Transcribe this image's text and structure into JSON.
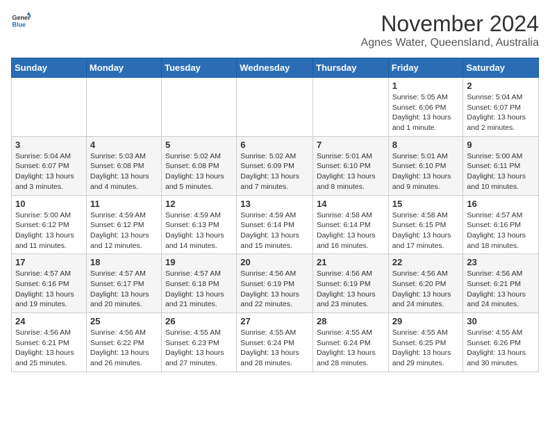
{
  "header": {
    "logo_line1": "General",
    "logo_line2": "Blue",
    "month": "November 2024",
    "location": "Agnes Water, Queensland, Australia"
  },
  "weekdays": [
    "Sunday",
    "Monday",
    "Tuesday",
    "Wednesday",
    "Thursday",
    "Friday",
    "Saturday"
  ],
  "weeks": [
    [
      {
        "day": "",
        "info": ""
      },
      {
        "day": "",
        "info": ""
      },
      {
        "day": "",
        "info": ""
      },
      {
        "day": "",
        "info": ""
      },
      {
        "day": "",
        "info": ""
      },
      {
        "day": "1",
        "info": "Sunrise: 5:05 AM\nSunset: 6:06 PM\nDaylight: 13 hours and 1 minute."
      },
      {
        "day": "2",
        "info": "Sunrise: 5:04 AM\nSunset: 6:07 PM\nDaylight: 13 hours and 2 minutes."
      }
    ],
    [
      {
        "day": "3",
        "info": "Sunrise: 5:04 AM\nSunset: 6:07 PM\nDaylight: 13 hours and 3 minutes."
      },
      {
        "day": "4",
        "info": "Sunrise: 5:03 AM\nSunset: 6:08 PM\nDaylight: 13 hours and 4 minutes."
      },
      {
        "day": "5",
        "info": "Sunrise: 5:02 AM\nSunset: 6:08 PM\nDaylight: 13 hours and 5 minutes."
      },
      {
        "day": "6",
        "info": "Sunrise: 5:02 AM\nSunset: 6:09 PM\nDaylight: 13 hours and 7 minutes."
      },
      {
        "day": "7",
        "info": "Sunrise: 5:01 AM\nSunset: 6:10 PM\nDaylight: 13 hours and 8 minutes."
      },
      {
        "day": "8",
        "info": "Sunrise: 5:01 AM\nSunset: 6:10 PM\nDaylight: 13 hours and 9 minutes."
      },
      {
        "day": "9",
        "info": "Sunrise: 5:00 AM\nSunset: 6:11 PM\nDaylight: 13 hours and 10 minutes."
      }
    ],
    [
      {
        "day": "10",
        "info": "Sunrise: 5:00 AM\nSunset: 6:12 PM\nDaylight: 13 hours and 11 minutes."
      },
      {
        "day": "11",
        "info": "Sunrise: 4:59 AM\nSunset: 6:12 PM\nDaylight: 13 hours and 12 minutes."
      },
      {
        "day": "12",
        "info": "Sunrise: 4:59 AM\nSunset: 6:13 PM\nDaylight: 13 hours and 14 minutes."
      },
      {
        "day": "13",
        "info": "Sunrise: 4:59 AM\nSunset: 6:14 PM\nDaylight: 13 hours and 15 minutes."
      },
      {
        "day": "14",
        "info": "Sunrise: 4:58 AM\nSunset: 6:14 PM\nDaylight: 13 hours and 16 minutes."
      },
      {
        "day": "15",
        "info": "Sunrise: 4:58 AM\nSunset: 6:15 PM\nDaylight: 13 hours and 17 minutes."
      },
      {
        "day": "16",
        "info": "Sunrise: 4:57 AM\nSunset: 6:16 PM\nDaylight: 13 hours and 18 minutes."
      }
    ],
    [
      {
        "day": "17",
        "info": "Sunrise: 4:57 AM\nSunset: 6:16 PM\nDaylight: 13 hours and 19 minutes."
      },
      {
        "day": "18",
        "info": "Sunrise: 4:57 AM\nSunset: 6:17 PM\nDaylight: 13 hours and 20 minutes."
      },
      {
        "day": "19",
        "info": "Sunrise: 4:57 AM\nSunset: 6:18 PM\nDaylight: 13 hours and 21 minutes."
      },
      {
        "day": "20",
        "info": "Sunrise: 4:56 AM\nSunset: 6:19 PM\nDaylight: 13 hours and 22 minutes."
      },
      {
        "day": "21",
        "info": "Sunrise: 4:56 AM\nSunset: 6:19 PM\nDaylight: 13 hours and 23 minutes."
      },
      {
        "day": "22",
        "info": "Sunrise: 4:56 AM\nSunset: 6:20 PM\nDaylight: 13 hours and 24 minutes."
      },
      {
        "day": "23",
        "info": "Sunrise: 4:56 AM\nSunset: 6:21 PM\nDaylight: 13 hours and 24 minutes."
      }
    ],
    [
      {
        "day": "24",
        "info": "Sunrise: 4:56 AM\nSunset: 6:21 PM\nDaylight: 13 hours and 25 minutes."
      },
      {
        "day": "25",
        "info": "Sunrise: 4:56 AM\nSunset: 6:22 PM\nDaylight: 13 hours and 26 minutes."
      },
      {
        "day": "26",
        "info": "Sunrise: 4:55 AM\nSunset: 6:23 PM\nDaylight: 13 hours and 27 minutes."
      },
      {
        "day": "27",
        "info": "Sunrise: 4:55 AM\nSunset: 6:24 PM\nDaylight: 13 hours and 28 minutes."
      },
      {
        "day": "28",
        "info": "Sunrise: 4:55 AM\nSunset: 6:24 PM\nDaylight: 13 hours and 28 minutes."
      },
      {
        "day": "29",
        "info": "Sunrise: 4:55 AM\nSunset: 6:25 PM\nDaylight: 13 hours and 29 minutes."
      },
      {
        "day": "30",
        "info": "Sunrise: 4:55 AM\nSunset: 6:26 PM\nDaylight: 13 hours and 30 minutes."
      }
    ]
  ]
}
